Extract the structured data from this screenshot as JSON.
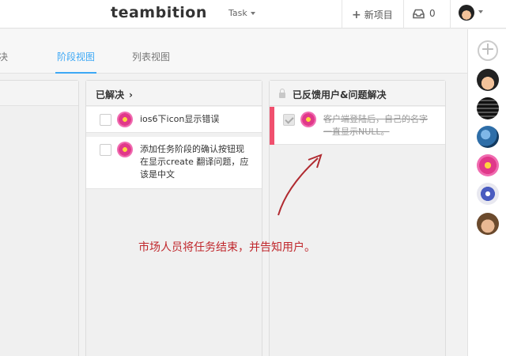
{
  "header": {
    "logo": "teambition",
    "project_select": "Task",
    "new_project_label": "新项目",
    "inbox_count": "0"
  },
  "tabs": [
    {
      "label": "决"
    },
    {
      "label": "阶段视图",
      "active": true
    },
    {
      "label": "列表视图"
    }
  ],
  "columns": [
    {
      "title": "已解决",
      "has_chevron": true,
      "cards": [
        {
          "text": "ios6下icon显示错误",
          "done": false,
          "avatar": "flower-avatar"
        },
        {
          "text_lines": [
            "添加任务阶段的确认按钮现",
            "在显示create 翻译问题，应",
            "该是中文"
          ],
          "done": false,
          "avatar": "flower-avatar"
        }
      ]
    },
    {
      "title": "已反馈用户&问题解决",
      "locked": true,
      "cards": [
        {
          "text_lines": [
            "客户端登陆后，自己的名字",
            "一直显示NULL。"
          ],
          "done": true,
          "avatar": "flower-avatar",
          "flag_color": "#f0506e"
        }
      ]
    }
  ],
  "annotation": {
    "text": "市场人员将任务结束，并告知用户。",
    "color": "#c0282d"
  },
  "members": [
    "face-avatar",
    "dark-pattern-avatar",
    "earth-avatar",
    "flower-avatar",
    "robot-avatar",
    "man-avatar"
  ],
  "colors": {
    "accent": "#3da8f5",
    "flag": "#f0506e"
  }
}
